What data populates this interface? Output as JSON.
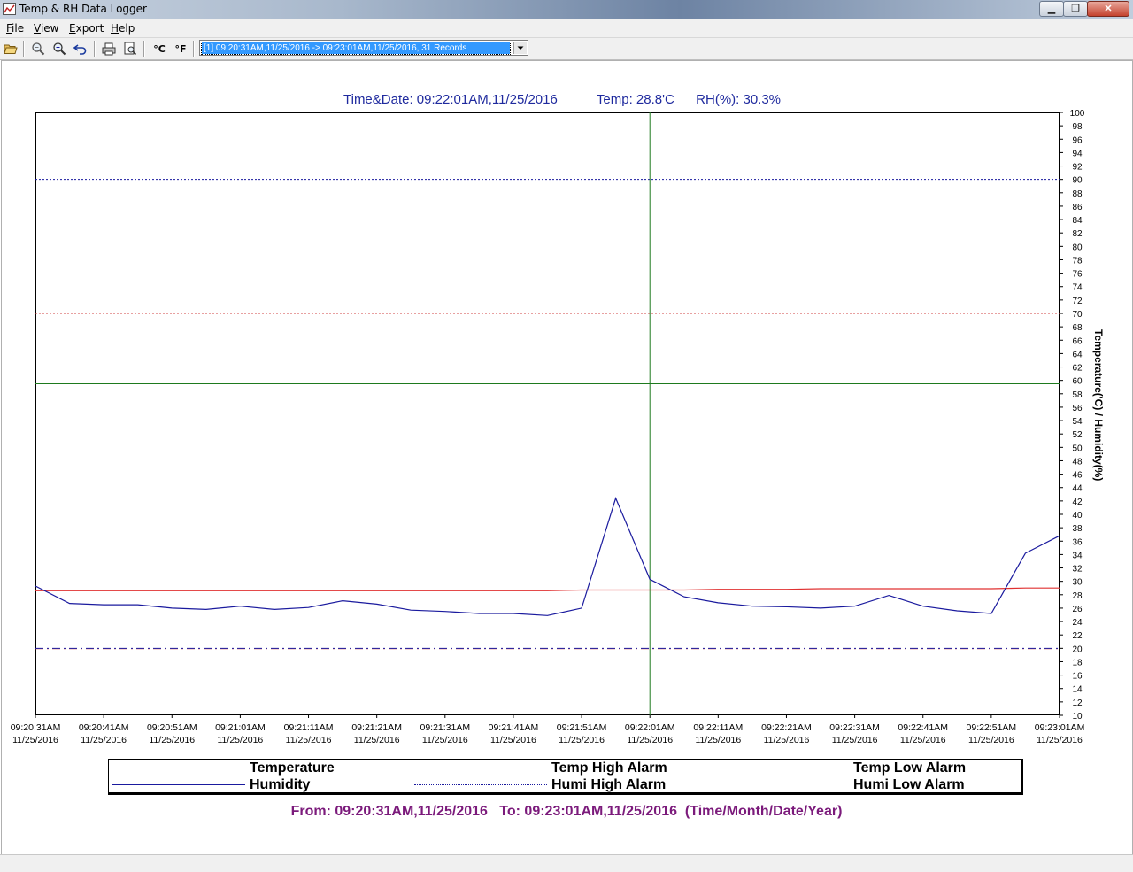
{
  "window": {
    "title": "Temp & RH Data Logger",
    "icon": "chart-line-icon",
    "controls": {
      "minimize": "minimize-icon",
      "maximize": "maximize-icon",
      "close": "close-icon"
    }
  },
  "menu": {
    "items": [
      {
        "label": "File"
      },
      {
        "label": "View"
      },
      {
        "label": "Export"
      },
      {
        "label": "Help"
      }
    ]
  },
  "toolbar": {
    "buttons": [
      {
        "icon": "open-folder-icon"
      },
      {
        "icon": "zoom-out-icon"
      },
      {
        "icon": "zoom-in-icon"
      },
      {
        "icon": "undo-zoom-icon"
      },
      {
        "icon": "print-icon"
      },
      {
        "icon": "print-preview-icon"
      },
      {
        "icon": "celsius-icon",
        "glyph": "°C"
      },
      {
        "icon": "fahrenheit-icon",
        "glyph": "°F"
      }
    ],
    "record_select": {
      "value": "[1] 09:20:31AM,11/25/2016 -> 09:23:01AM,11/25/2016, 31 Records"
    }
  },
  "readout": {
    "time": "Time&Date: 09:22:01AM,11/25/2016",
    "temp": "Temp: 28.8'C",
    "rh": "RH(%): 30.3%"
  },
  "legend": {
    "temperature": "Temperature",
    "humidity": "Humidity",
    "temp_high": "Temp High Alarm",
    "humi_high": "Humi High Alarm",
    "temp_low": "Temp Low Alarm",
    "humi_low": "Humi Low Alarm"
  },
  "footer": {
    "from": "From: 09:20:31AM,11/25/2016",
    "to": "To: 09:23:01AM,11/25/2016",
    "format": "(Time/Month/Date/Year)"
  },
  "colors": {
    "temperature": "#e03030",
    "humidity": "#1a1a9e",
    "temp_alarm": "#d04040",
    "humi_alarm": "#1a1a9e",
    "cursor": "#1e7a1e",
    "readout": "#1f2a9e",
    "footer": "#7b1a7b"
  },
  "chart_data": {
    "type": "line",
    "ylabel": "Temperature('C) / Humidity(%)",
    "ylim": [
      10,
      100
    ],
    "y_ticks": [
      10,
      12,
      14,
      16,
      18,
      20,
      22,
      24,
      26,
      28,
      30,
      32,
      34,
      36,
      38,
      40,
      42,
      44,
      46,
      48,
      50,
      52,
      54,
      56,
      58,
      60,
      62,
      64,
      66,
      68,
      70,
      72,
      74,
      76,
      78,
      80,
      82,
      84,
      86,
      88,
      90,
      92,
      94,
      96,
      98,
      100
    ],
    "x_tick_labels": [
      [
        "09:20:31AM",
        "11/25/2016"
      ],
      [
        "09:20:41AM",
        "11/25/2016"
      ],
      [
        "09:20:51AM",
        "11/25/2016"
      ],
      [
        "09:21:01AM",
        "11/25/2016"
      ],
      [
        "09:21:11AM",
        "11/25/2016"
      ],
      [
        "09:21:21AM",
        "11/25/2016"
      ],
      [
        "09:21:31AM",
        "11/25/2016"
      ],
      [
        "09:21:41AM",
        "11/25/2016"
      ],
      [
        "09:21:51AM",
        "11/25/2016"
      ],
      [
        "09:22:01AM",
        "11/25/2016"
      ],
      [
        "09:22:11AM",
        "11/25/2016"
      ],
      [
        "09:22:21AM",
        "11/25/2016"
      ],
      [
        "09:22:31AM",
        "11/25/2016"
      ],
      [
        "09:22:41AM",
        "11/25/2016"
      ],
      [
        "09:22:51AM",
        "11/25/2016"
      ],
      [
        "09:23:01AM",
        "11/25/2016"
      ]
    ],
    "x_step_seconds": 5,
    "series": [
      {
        "name": "Temperature",
        "color": "#e03030",
        "values": [
          28.6,
          28.6,
          28.6,
          28.6,
          28.6,
          28.6,
          28.6,
          28.6,
          28.6,
          28.6,
          28.6,
          28.6,
          28.6,
          28.6,
          28.6,
          28.6,
          28.7,
          28.7,
          28.7,
          28.7,
          28.8,
          28.8,
          28.8,
          28.9,
          28.9,
          28.9,
          28.9,
          28.9,
          28.9,
          29.0,
          29.0
        ]
      },
      {
        "name": "Humidity",
        "color": "#1a1a9e",
        "values": [
          29.3,
          26.7,
          26.5,
          26.5,
          26.0,
          25.8,
          26.3,
          25.8,
          26.1,
          27.1,
          26.6,
          25.7,
          25.5,
          25.2,
          25.2,
          24.9,
          26.0,
          42.4,
          30.3,
          27.7,
          26.8,
          26.3,
          26.2,
          26.0,
          26.3,
          27.9,
          26.3,
          25.6,
          25.2,
          34.2,
          36.8
        ]
      }
    ],
    "alarms": {
      "temp_high": 70,
      "temp_low": 20,
      "humi_high": 90,
      "humi_low": 20
    },
    "cursor": {
      "time": "09:22:01AM",
      "index": 18,
      "level": 59.5
    },
    "grid": false
  }
}
